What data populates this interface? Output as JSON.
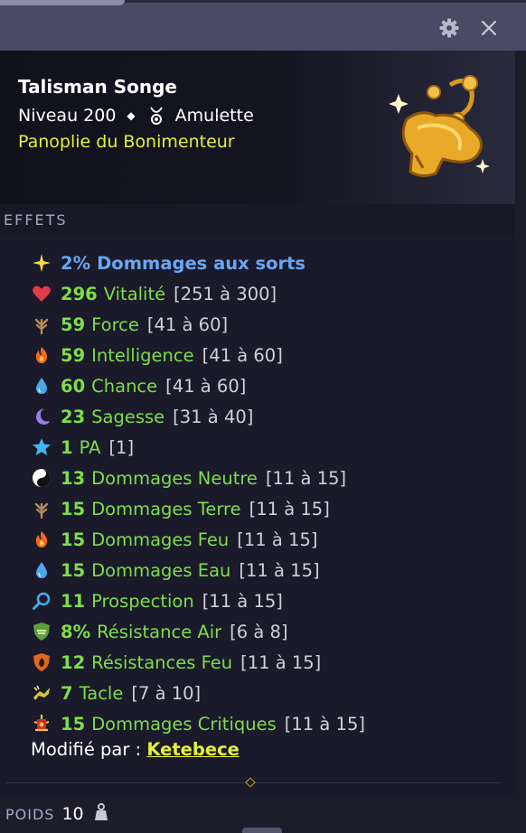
{
  "window": {
    "settings_icon": "gear-icon",
    "close_icon": "close-icon"
  },
  "item": {
    "name": "Talisman Songe",
    "level": "Niveau 200",
    "separator": "◆",
    "type": "Amulette",
    "set": "Panoplie du Bonimenteur"
  },
  "effects_label": "EFFETS",
  "effects": [
    {
      "icon": "star-icon",
      "value": "2%",
      "name": "Dommages aux sorts",
      "range": "",
      "special": true
    },
    {
      "icon": "heart-icon",
      "value": "296",
      "name": "Vitalité",
      "range": "[251 à 300]"
    },
    {
      "icon": "earth-icon",
      "value": "59",
      "name": "Force",
      "range": "[41 à 60]"
    },
    {
      "icon": "fire-icon",
      "value": "59",
      "name": "Intelligence",
      "range": "[41 à 60]"
    },
    {
      "icon": "water-icon",
      "value": "60",
      "name": "Chance",
      "range": "[41 à 60]"
    },
    {
      "icon": "moon-icon",
      "value": "23",
      "name": "Sagesse",
      "range": "[31 à 40]"
    },
    {
      "icon": "ap-star-icon",
      "value": "1",
      "name": "PA",
      "range": "[1]"
    },
    {
      "icon": "yinyang-icon",
      "value": "13",
      "name": "Dommages Neutre",
      "range": "[11 à 15]"
    },
    {
      "icon": "earth-icon",
      "value": "15",
      "name": "Dommages Terre",
      "range": "[11 à 15]"
    },
    {
      "icon": "fire-icon",
      "value": "15",
      "name": "Dommages Feu",
      "range": "[11 à 15]"
    },
    {
      "icon": "water-icon",
      "value": "15",
      "name": "Dommages Eau",
      "range": "[11 à 15]"
    },
    {
      "icon": "magnifier-icon",
      "value": "11",
      "name": "Prospection",
      "range": "[11 à 15]"
    },
    {
      "icon": "air-shield-icon",
      "value": "8%",
      "name": "Résistance Air",
      "range": "[6 à 8]"
    },
    {
      "icon": "fire-shield-icon",
      "value": "12",
      "name": "Résistances Feu",
      "range": "[11 à 15]"
    },
    {
      "icon": "tackle-icon",
      "value": "7",
      "name": "Tacle",
      "range": "[7 à 10]"
    },
    {
      "icon": "critical-icon",
      "value": "15",
      "name": "Dommages Critiques",
      "range": "[11 à 15]"
    }
  ],
  "modified_label": "Modifié par : ",
  "modified_by": "Ketebece",
  "weight": {
    "label": "POIDS",
    "value": "10",
    "icon": "weight-icon"
  }
}
